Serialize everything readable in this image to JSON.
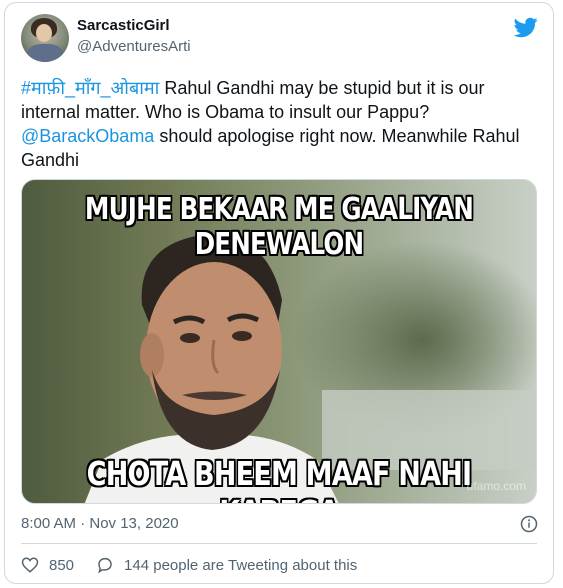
{
  "tweet": {
    "author": {
      "name": "SarcasticGirl",
      "handle": "@AdventuresArti"
    },
    "text": {
      "hashtag": "#माफ़ी_माँग_ओबामा",
      "part1": " Rahul Gandhi may be stupid but it is our internal matter. Who is Obama to insult our Pappu?",
      "mention": "@BarackObama",
      "part2": " should apologise right now. Meanwhile Rahul Gandhi"
    },
    "media": {
      "top_caption": "MUJHE BEKAAR ME GAALIYAN DENEWALON",
      "bottom_caption": "CHOTA BHEEM MAAF NAHI KAREGA",
      "watermark": "ufamo.com"
    },
    "timestamp": "8:00 AM · Nov 13, 2020",
    "likes": "850",
    "conversation": "144 people are Tweeting about this"
  },
  "colors": {
    "twitter_blue": "#1d9bf0",
    "link": "#1b95e0",
    "secondary_text": "#536471",
    "border": "#cfd9de"
  },
  "icons": {
    "brand": "twitter-bird-icon",
    "info": "info-icon",
    "like": "heart-icon",
    "reply": "speech-bubble-icon"
  }
}
